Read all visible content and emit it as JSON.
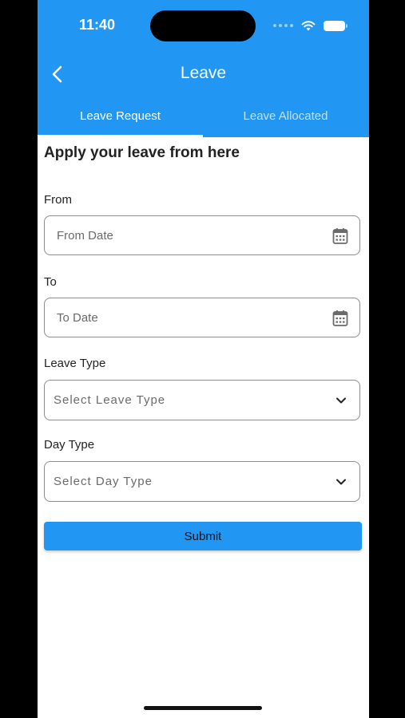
{
  "status_bar": {
    "time": "11:40"
  },
  "app_bar": {
    "title": "Leave"
  },
  "tabs": [
    {
      "label": "Leave Request",
      "selected": true
    },
    {
      "label": "Leave Allocated",
      "selected": false
    }
  ],
  "form": {
    "heading": "Apply your leave from here",
    "from": {
      "label": "From",
      "placeholder": "From Date"
    },
    "to": {
      "label": "To",
      "placeholder": "To Date"
    },
    "leave_type": {
      "label": "Leave Type",
      "placeholder": "Select Leave Type"
    },
    "day_type": {
      "label": "Day Type",
      "placeholder": "Select Day Type"
    },
    "submit_label": "Submit"
  },
  "colors": {
    "primary": "#2196F3",
    "background": "#FFFFFF",
    "frame": "#000000"
  },
  "icons": [
    "back-arrow-icon",
    "calendar-icon",
    "chevron-down-icon",
    "wifi-icon",
    "battery-icon"
  ]
}
